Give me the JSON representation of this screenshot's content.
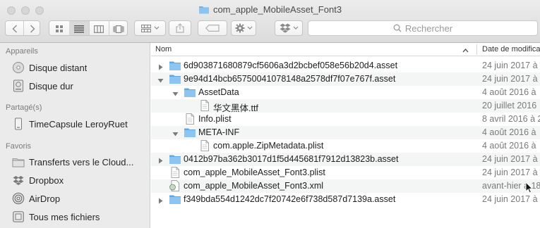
{
  "window": {
    "title": "com_apple_MobileAsset_Font3"
  },
  "toolbar": {
    "search_placeholder": "Rechercher"
  },
  "sidebar": {
    "sections": [
      {
        "heading": "Appareils",
        "items": [
          {
            "label": "Disque distant",
            "icon": "disc-icon"
          },
          {
            "label": "Disque dur",
            "icon": "hard-drive-icon"
          }
        ]
      },
      {
        "heading": "Partagé(s)",
        "items": [
          {
            "label": "TimeCapsule LeroyRuet",
            "icon": "time-capsule-icon"
          }
        ]
      },
      {
        "heading": "Favoris",
        "items": [
          {
            "label": "Transferts vers le Cloud...",
            "icon": "folder-icon"
          },
          {
            "label": "Dropbox",
            "icon": "dropbox-icon"
          },
          {
            "label": "AirDrop",
            "icon": "airdrop-icon"
          },
          {
            "label": "Tous mes fichiers",
            "icon": "all-files-icon"
          }
        ]
      }
    ]
  },
  "list": {
    "columns": {
      "name": "Nom",
      "date": "Date de modifica"
    },
    "rows": [
      {
        "name": "6d903871680879cf5606a3d2bcbef058e56b20d4.asset",
        "date": "24 juin 2017 à",
        "kind": "folder",
        "level": 0,
        "disclosure": "collapsed"
      },
      {
        "name": "9e94d14bcb65750041078148a2578df7f07e767f.asset",
        "date": "24 juin 2017 à",
        "kind": "folder",
        "level": 0,
        "disclosure": "expanded"
      },
      {
        "name": "AssetData",
        "date": "4 août 2016 à",
        "kind": "folder",
        "level": 1,
        "disclosure": "expanded"
      },
      {
        "name": "华文黑体.ttf",
        "date": "20 juillet 2016",
        "kind": "file",
        "level": 2,
        "disclosure": "none"
      },
      {
        "name": "Info.plist",
        "date": "8 avril 2016 à 2",
        "kind": "file",
        "level": 1,
        "disclosure": "none"
      },
      {
        "name": "META-INF",
        "date": "4 août 2016 à",
        "kind": "folder",
        "level": 1,
        "disclosure": "expanded"
      },
      {
        "name": "com.apple.ZipMetadata.plist",
        "date": "4 août 2016 à",
        "kind": "file",
        "level": 2,
        "disclosure": "none"
      },
      {
        "name": "0412b97ba362b3017d1f5d445681f7912d13823b.asset",
        "date": "24 juin 2017 à",
        "kind": "folder",
        "level": 0,
        "disclosure": "collapsed"
      },
      {
        "name": "com_apple_MobileAsset_Font3.plist",
        "date": "24 juin 2017 à",
        "kind": "file",
        "level": 0,
        "disclosure": "none"
      },
      {
        "name": "com_apple_MobileAsset_Font3.xml",
        "date": "avant-hier à 18",
        "kind": "xml",
        "level": 0,
        "disclosure": "none"
      },
      {
        "name": "f349bda554d1242dc7f20742e6f738d587d7139a.asset",
        "date": "24 juin 2017 à",
        "kind": "folder",
        "level": 0,
        "disclosure": "collapsed"
      }
    ]
  }
}
